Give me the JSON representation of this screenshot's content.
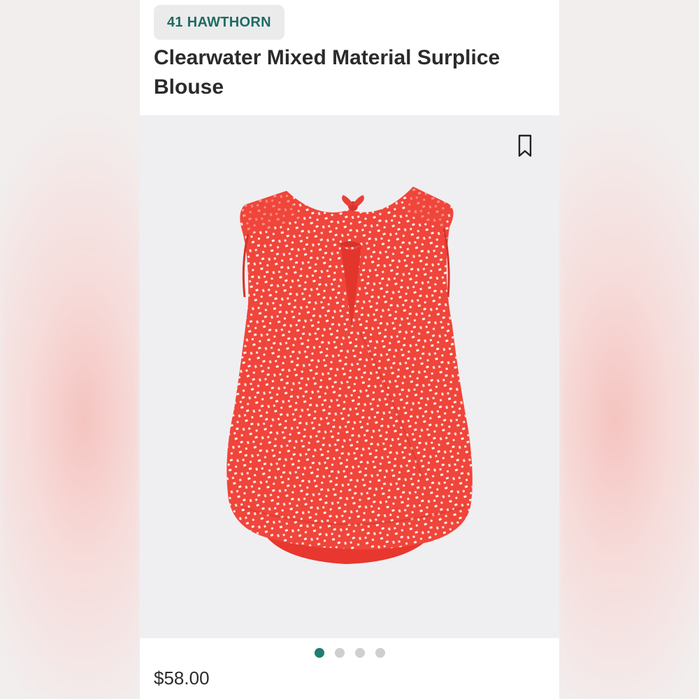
{
  "product": {
    "brand": "41 HAWTHORN",
    "title": "Clearwater Mixed Material Surplice Blouse",
    "price": "$58.00",
    "image_icon": "sleeveless-blouse-image"
  },
  "gallery": {
    "total_images": 4,
    "active_index": 0
  },
  "colors": {
    "brand_text": "#1f6b64",
    "active_dot": "#1f7d74",
    "inactive_dot": "#cfcfcf",
    "garment": "#f0453a",
    "garment_print": "#ffffff"
  },
  "icons": {
    "bookmark": "bookmark-icon"
  }
}
